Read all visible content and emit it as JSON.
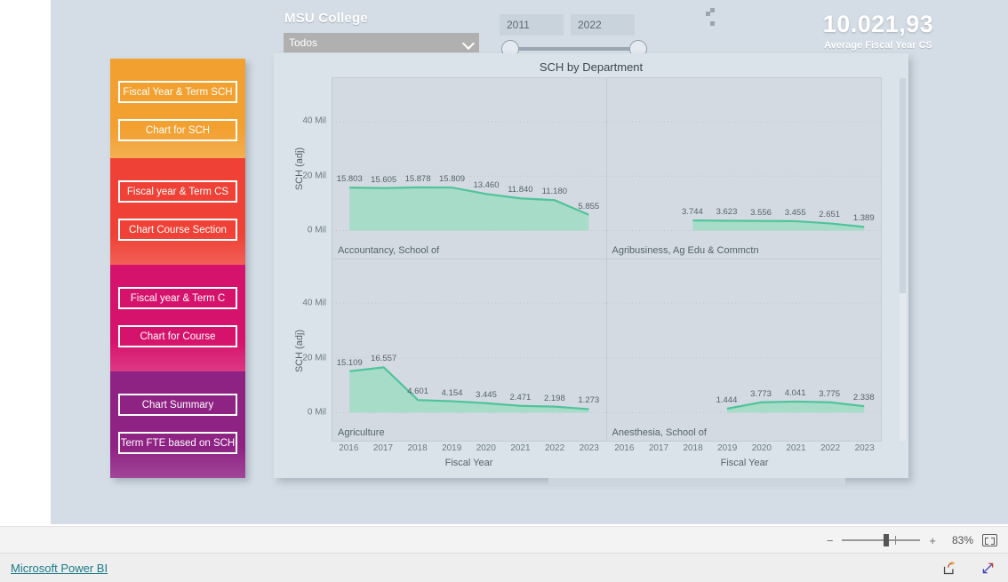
{
  "report": {
    "title": "MSU College",
    "college_slicer": {
      "value": "Todos",
      "chevron_icon": "chevron-down-icon"
    },
    "year_range": {
      "from": "2011",
      "to": "2022"
    },
    "kpi": {
      "value": "10.021,93",
      "label": "Average Fiscal Year CS"
    }
  },
  "sidebar": {
    "bands": [
      {
        "color": "#f2a030",
        "buttons": [
          "Fiscal Year & Term SCH",
          "Chart for SCH"
        ]
      },
      {
        "color": "#ef4136",
        "buttons": [
          "Fiscal year & Term CS",
          "Chart Course Section"
        ]
      },
      {
        "color": "#d6136c",
        "buttons": [
          "Fiscal year & Term C",
          "Chart for Course"
        ]
      },
      {
        "color": "#8f2384",
        "buttons": [
          "Chart Summary",
          "Term FTE based on SCH"
        ]
      }
    ]
  },
  "chart_data": {
    "type": "area",
    "title": "SCH by Department",
    "xlabel": "Fiscal Year",
    "ylabel": "SCH (adj)",
    "x": [
      "2016",
      "2017",
      "2018",
      "2019",
      "2020",
      "2021",
      "2022",
      "2023"
    ],
    "yticks": [
      "0 Mil",
      "20 Mil",
      "40 Mil"
    ],
    "ylim": [
      0,
      50
    ],
    "grid": true,
    "legend": "none",
    "series_color": "#4fc39a",
    "fill_color": "#9fdcc3",
    "panels": [
      {
        "name": "Accountancy, School of",
        "labels": [
          "15.803",
          "15.605",
          "15.878",
          "15.809",
          "13.460",
          "11.840",
          "11.180",
          "5.855"
        ],
        "values": [
          15.803,
          15.605,
          15.878,
          15.809,
          13.46,
          11.84,
          11.18,
          5.855
        ],
        "x": [
          "2016",
          "2017",
          "2018",
          "2019",
          "2020",
          "2021",
          "2022",
          "2023"
        ]
      },
      {
        "name": "Agribusiness, Ag Edu & Commctn",
        "labels": [
          "3.744",
          "3.623",
          "3.556",
          "3.455",
          "2.651",
          "1.389"
        ],
        "values": [
          3.744,
          3.623,
          3.556,
          3.455,
          2.651,
          1.389
        ],
        "x": [
          "2018",
          "2019",
          "2020",
          "2021",
          "2022",
          "2023"
        ]
      },
      {
        "name": "Agriculture",
        "labels": [
          "15.109",
          "16.557",
          "4.601",
          "4.154",
          "3.445",
          "2.471",
          "2.198",
          "1.273"
        ],
        "values": [
          15.109,
          16.557,
          4.601,
          4.154,
          3.445,
          2.471,
          2.198,
          1.273
        ],
        "x": [
          "2016",
          "2017",
          "2018",
          "2019",
          "2020",
          "2021",
          "2022",
          "2023"
        ]
      },
      {
        "name": "Anesthesia, School of",
        "labels": [
          "1.444",
          "3.773",
          "4.041",
          "3.775",
          "2.338"
        ],
        "values": [
          1.444,
          3.773,
          4.041,
          3.775,
          2.338
        ],
        "x": [
          "2019",
          "2020",
          "2021",
          "2022",
          "2023"
        ]
      }
    ]
  },
  "zoombar": {
    "minus": "−",
    "plus": "+",
    "percent": "83%",
    "fit_icon": "fit-to-page-icon"
  },
  "footer": {
    "brand": "Microsoft Power BI",
    "share_icon": "share-icon",
    "fullscreen_icon": "fullscreen-icon"
  }
}
